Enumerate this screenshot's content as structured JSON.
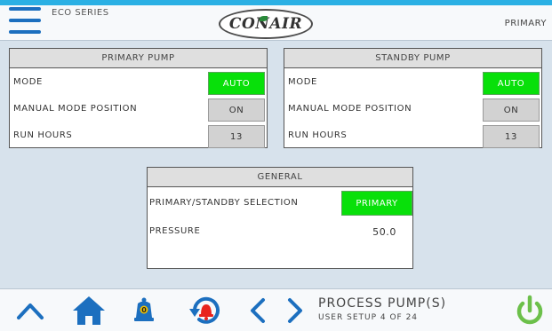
{
  "header": {
    "series": "ECO SERIES",
    "logo_text": "CONAIR",
    "mode_indicator": "PRIMARY"
  },
  "primary_pump": {
    "title": "PRIMARY PUMP",
    "rows": [
      {
        "label": "MODE",
        "value": "AUTO"
      },
      {
        "label": "MANUAL MODE POSITION",
        "value": "ON"
      },
      {
        "label": "RUN HOURS",
        "value": "13"
      }
    ]
  },
  "standby_pump": {
    "title": "STANDBY PUMP",
    "rows": [
      {
        "label": "MODE",
        "value": "AUTO"
      },
      {
        "label": "MANUAL MODE POSITION",
        "value": "ON"
      },
      {
        "label": "RUN HOURS",
        "value": "13"
      }
    ]
  },
  "general": {
    "title": "GENERAL",
    "selection_label": "PRIMARY/STANDBY SELECTION",
    "selection_value": "PRIMARY",
    "pressure_label": "PRESSURE",
    "pressure_value": "50.0"
  },
  "footer": {
    "title": "PROCESS PUMP(S)",
    "subtitle": "USER SETUP 4 OF 24",
    "alarm_badge": "0",
    "icons": [
      "up-arrow-icon",
      "home-icon",
      "bell-icon",
      "alarm-history-icon",
      "chevron-left-icon",
      "chevron-right-icon",
      "power-icon"
    ]
  },
  "colors": {
    "accent_blue": "#1c6fbf",
    "active_green": "#08e00a",
    "value_gray": "#d2d2d2",
    "background": "#d7e2ec",
    "alarm_red": "#e8231c",
    "power_green": "#6cc04a"
  }
}
